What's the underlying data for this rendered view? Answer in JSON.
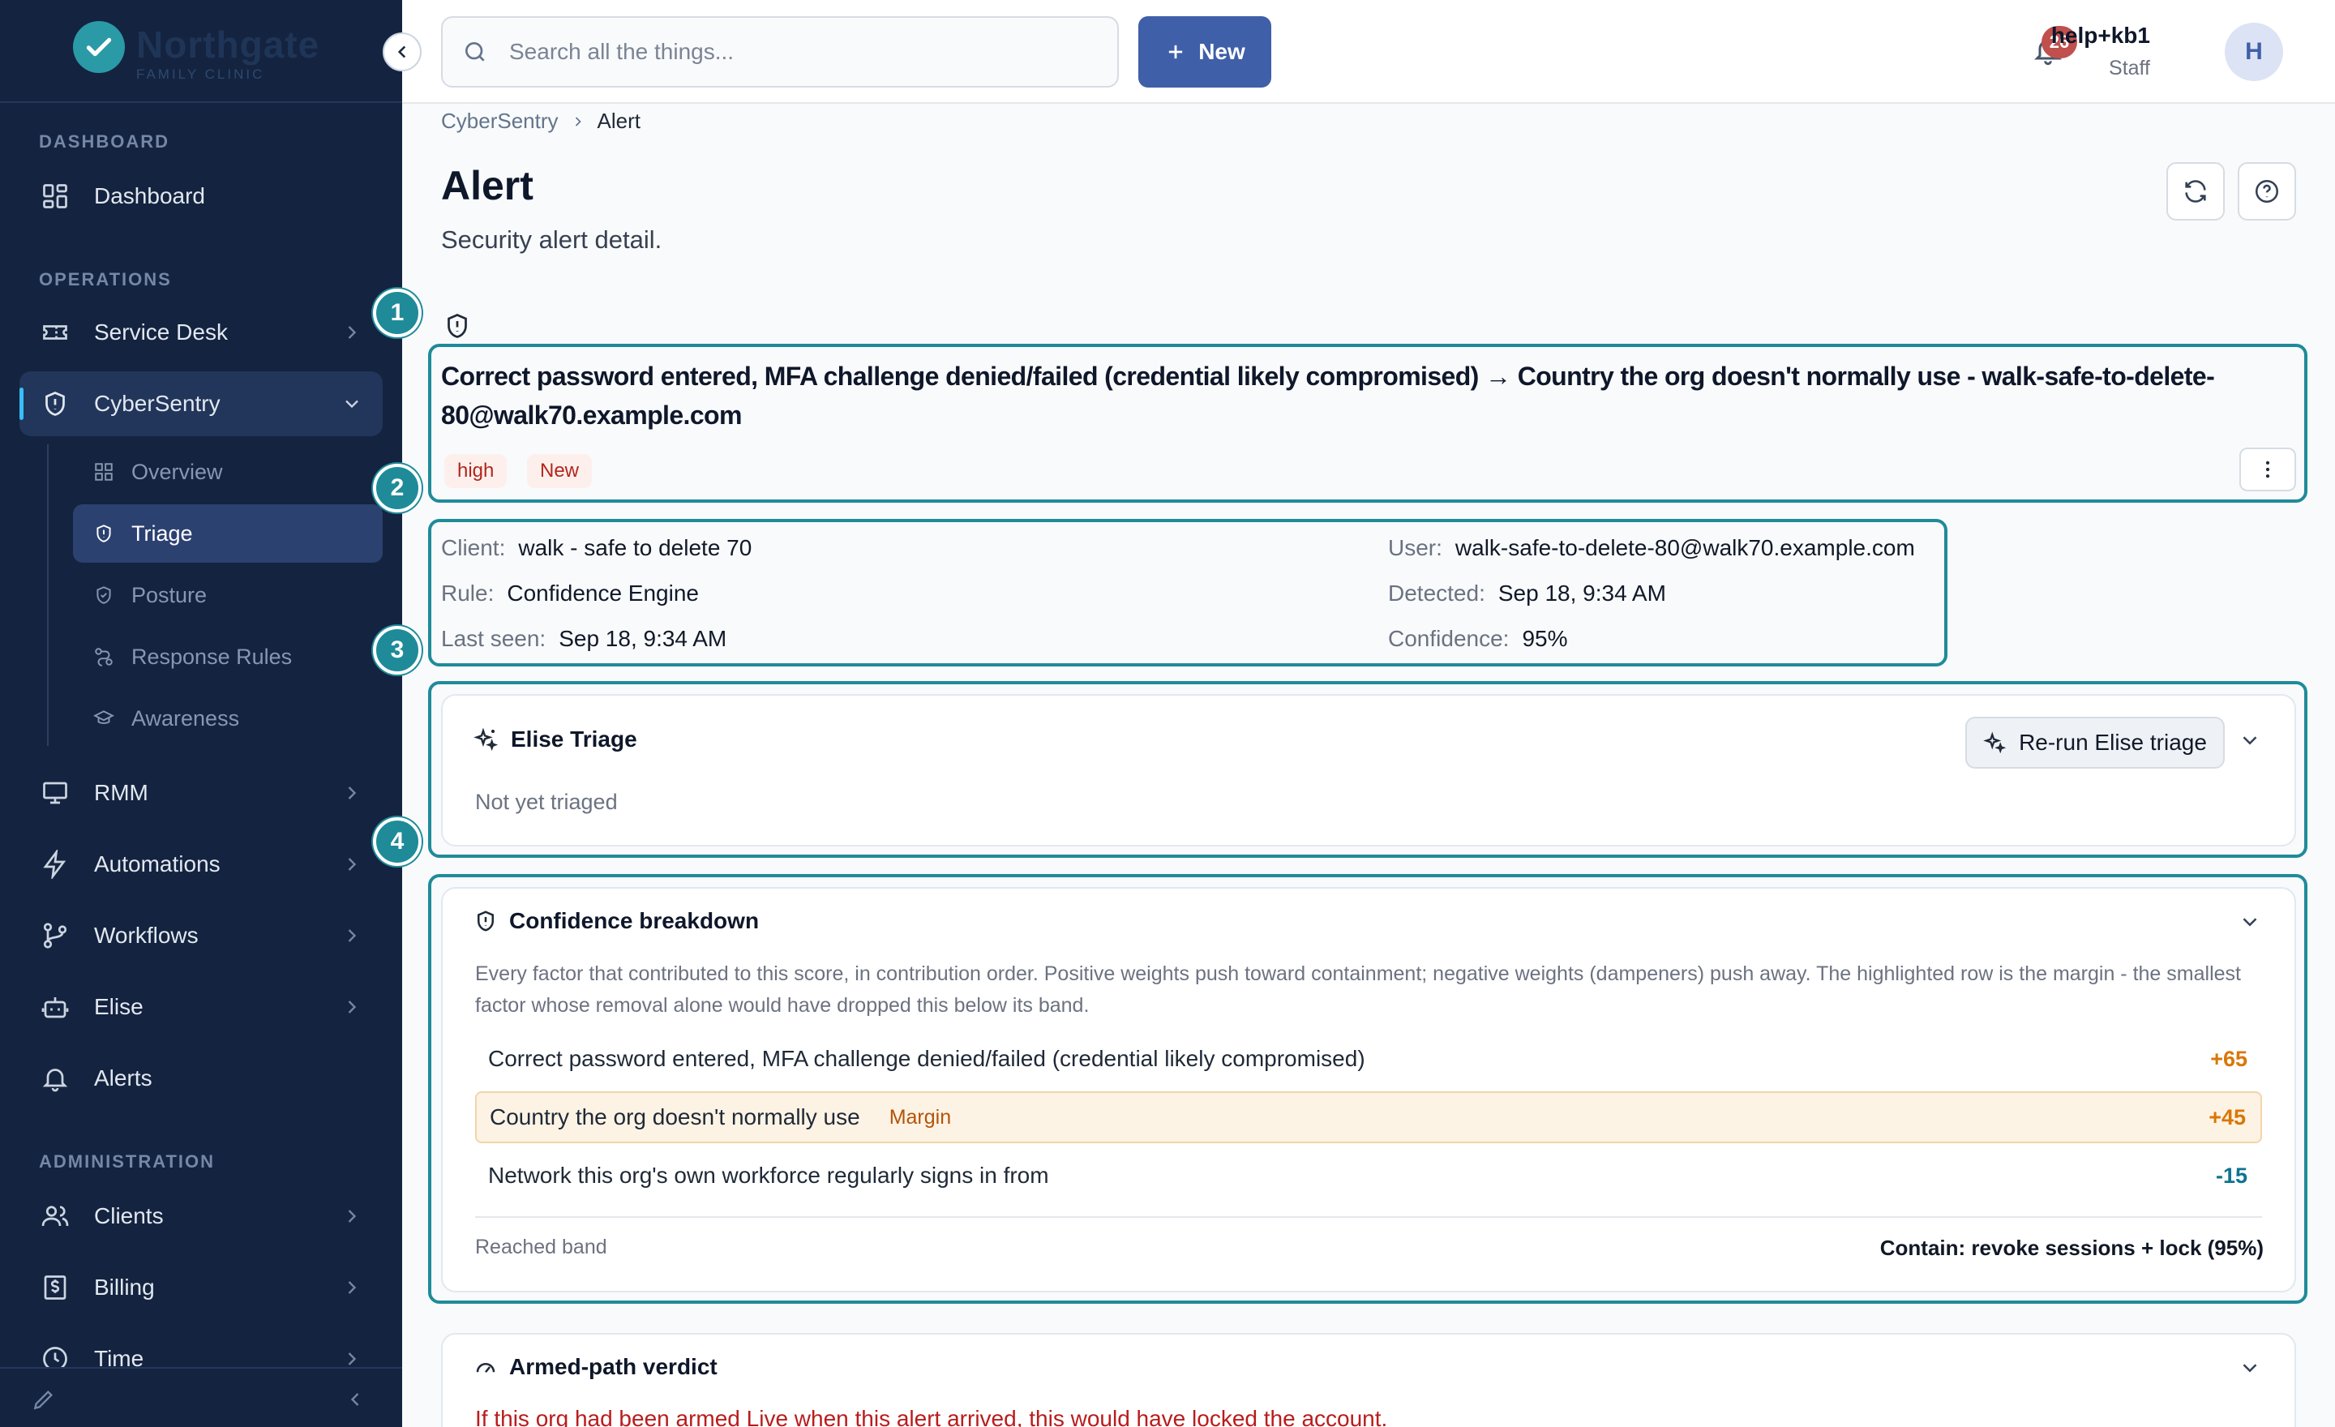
{
  "brand": {
    "name": "Northgate",
    "subtitle": "FAMILY CLINIC"
  },
  "sidebar": {
    "sections": {
      "dashboard": "DASHBOARD",
      "operations": "OPERATIONS",
      "administration": "ADMINISTRATION"
    },
    "items": {
      "dashboard": "Dashboard",
      "service_desk": "Service Desk",
      "cybersentry": "CyberSentry",
      "rmm": "RMM",
      "automations": "Automations",
      "workflows": "Workflows",
      "elise": "Elise",
      "alerts": "Alerts",
      "clients": "Clients",
      "billing": "Billing",
      "time": "Time"
    },
    "subitems": {
      "overview": "Overview",
      "triage": "Triage",
      "posture": "Posture",
      "response_rules": "Response Rules",
      "awareness": "Awareness"
    }
  },
  "topbar": {
    "search_placeholder": "Search all the things...",
    "new_label": "New",
    "notification_count": "26",
    "user_name": "help+kb1",
    "user_role": "Staff",
    "avatar_initial": "H"
  },
  "breadcrumb": {
    "parent": "CyberSentry",
    "current": "Alert"
  },
  "page": {
    "title": "Alert",
    "subtitle": "Security alert detail."
  },
  "steps": [
    "1",
    "2",
    "3",
    "4"
  ],
  "alert": {
    "title": "Correct password entered, MFA challenge denied/failed (credential likely compromised) → Country the org doesn't normally use - walk-safe-to-delete-80@walk70.example.com",
    "severity": "high",
    "status": "New"
  },
  "meta": {
    "client_label": "Client:",
    "client": "walk - safe to delete 70",
    "rule_label": "Rule:",
    "rule": "Confidence Engine",
    "last_seen_label": "Last seen:",
    "last_seen": "Sep 18, 9:34 AM",
    "user_label": "User:",
    "user": "walk-safe-to-delete-80@walk70.example.com",
    "detected_label": "Detected:",
    "detected": "Sep 18, 9:34 AM",
    "confidence_label": "Confidence:",
    "confidence": "95%"
  },
  "triage": {
    "title": "Elise Triage",
    "rerun_label": "Re-run Elise triage",
    "status": "Not yet triaged"
  },
  "confidence": {
    "title": "Confidence breakdown",
    "description": "Every factor that contributed to this score, in contribution order. Positive weights push toward containment; negative weights (dampeners) push away. The highlighted row is the margin - the smallest factor whose removal alone would have dropped this below its band.",
    "factors": [
      {
        "label": "Correct password entered, MFA challenge denied/failed (credential likely compromised)",
        "weight": "+65"
      },
      {
        "label": "Country the org doesn't normally use",
        "weight": "+45",
        "tag": "Margin"
      },
      {
        "label": "Network this org's own workforce regularly signs in from",
        "weight": "-15"
      }
    ],
    "band_label": "Reached band",
    "band_value": "Contain: revoke sessions + lock (95%)"
  },
  "verdict": {
    "title": "Armed-path verdict",
    "text": "If this org had been armed Live when this alert arrived, this would have locked the account."
  },
  "colors": {
    "sidebar": "#14233f",
    "accent": "#3f5fa8",
    "highlight": "#1f8b99",
    "severity": "#b3261e"
  }
}
